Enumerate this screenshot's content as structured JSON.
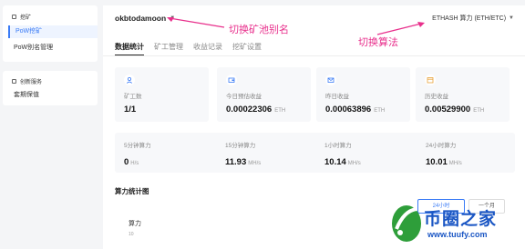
{
  "sidebar": {
    "group1_title": "挖矿",
    "items": [
      {
        "label": "PoW挖矿",
        "active": true
      },
      {
        "label": "PoW别名管理",
        "active": false
      }
    ],
    "group2_title": "创新服务",
    "group2_items": [
      {
        "label": "套期保值"
      }
    ]
  },
  "header": {
    "account": "okbtodamoon",
    "algo": "ETHASH 算力 (ETH/ETC)"
  },
  "annotations": {
    "switch_alias": "切换矿池别名",
    "switch_algo": "切换算法"
  },
  "tabs": [
    {
      "label": "数据统计",
      "active": true
    },
    {
      "label": "矿工管理",
      "active": false
    },
    {
      "label": "收益记录",
      "active": false
    },
    {
      "label": "挖矿设置",
      "active": false
    }
  ],
  "cards": [
    {
      "icon": "worker-icon",
      "label": "矿工数",
      "value": "1/1",
      "unit": ""
    },
    {
      "icon": "wallet-icon",
      "label": "今日预估收益",
      "value": "0.00022306",
      "unit": "ETH"
    },
    {
      "icon": "envelope-icon",
      "label": "昨日收益",
      "value": "0.00063896",
      "unit": "ETH"
    },
    {
      "icon": "calendar-icon",
      "label": "历史收益",
      "value": "0.00529900",
      "unit": "ETH"
    }
  ],
  "hashrates": [
    {
      "label": "5分钟算力",
      "value": "0",
      "unit": "H/s"
    },
    {
      "label": "15分钟算力",
      "value": "11.93",
      "unit": "MH/s"
    },
    {
      "label": "1小时算力",
      "value": "10.14",
      "unit": "MH/s"
    },
    {
      "label": "24小时算力",
      "value": "10.01",
      "unit": "MH/s"
    }
  ],
  "chart": {
    "title": "算力统计图",
    "btn_24h": "24小时",
    "btn_month": "一个月",
    "y_label": "算力",
    "y_tick": "10"
  },
  "watermark": {
    "text": "币圈之家",
    "url": "www.tuufy.com"
  },
  "colors": {
    "accent": "#3a7bf6",
    "annotation": "#e8308c",
    "watermark": "#1a56c4"
  }
}
